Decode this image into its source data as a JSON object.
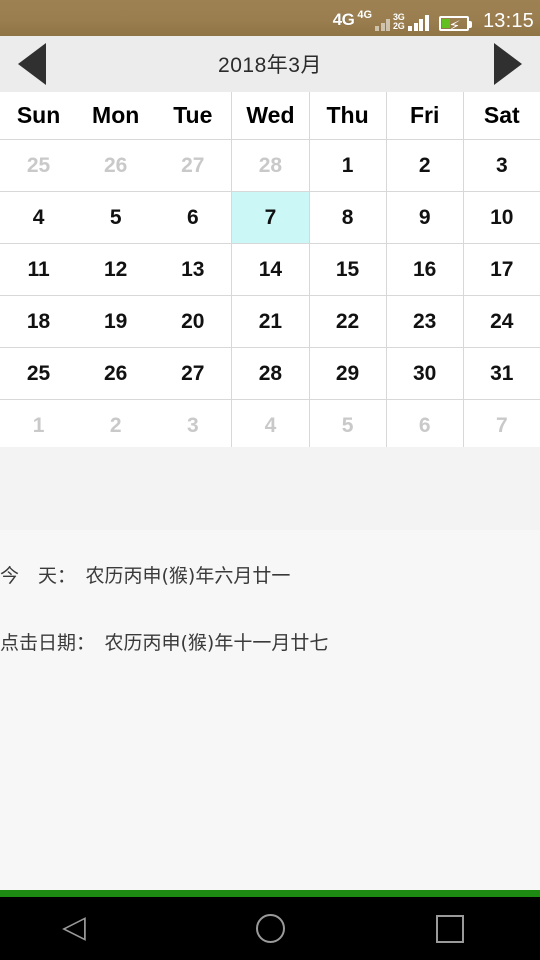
{
  "status_bar": {
    "network_primary": "4G",
    "network_secondary": "4G",
    "network_tertiary_top": "3G",
    "network_tertiary_bottom": "2G",
    "clock": "13:15",
    "background_color": "#9a7e4f"
  },
  "header": {
    "prev_label": "◀",
    "next_label": "▶",
    "title": "2018年3月"
  },
  "calendar": {
    "weekdays": [
      "Sun",
      "Mon",
      "Tue",
      "Wed",
      "Thu",
      "Fri",
      "Sat"
    ],
    "selected_color": "#ccf7f7",
    "rows": [
      [
        {
          "d": "25",
          "t": "prev"
        },
        {
          "d": "26",
          "t": "prev"
        },
        {
          "d": "27",
          "t": "prev"
        },
        {
          "d": "28",
          "t": "prev"
        },
        {
          "d": "1",
          "t": "cur"
        },
        {
          "d": "2",
          "t": "cur"
        },
        {
          "d": "3",
          "t": "cur"
        }
      ],
      [
        {
          "d": "4",
          "t": "cur"
        },
        {
          "d": "5",
          "t": "cur"
        },
        {
          "d": "6",
          "t": "cur"
        },
        {
          "d": "7",
          "t": "selected"
        },
        {
          "d": "8",
          "t": "cur"
        },
        {
          "d": "9",
          "t": "cur"
        },
        {
          "d": "10",
          "t": "cur"
        }
      ],
      [
        {
          "d": "11",
          "t": "cur"
        },
        {
          "d": "12",
          "t": "cur"
        },
        {
          "d": "13",
          "t": "cur"
        },
        {
          "d": "14",
          "t": "cur"
        },
        {
          "d": "15",
          "t": "cur"
        },
        {
          "d": "16",
          "t": "cur"
        },
        {
          "d": "17",
          "t": "cur"
        }
      ],
      [
        {
          "d": "18",
          "t": "cur"
        },
        {
          "d": "19",
          "t": "cur"
        },
        {
          "d": "20",
          "t": "cur"
        },
        {
          "d": "21",
          "t": "cur"
        },
        {
          "d": "22",
          "t": "cur"
        },
        {
          "d": "23",
          "t": "cur"
        },
        {
          "d": "24",
          "t": "cur"
        }
      ],
      [
        {
          "d": "25",
          "t": "cur"
        },
        {
          "d": "26",
          "t": "cur"
        },
        {
          "d": "27",
          "t": "cur"
        },
        {
          "d": "28",
          "t": "cur"
        },
        {
          "d": "29",
          "t": "cur"
        },
        {
          "d": "30",
          "t": "cur"
        },
        {
          "d": "31",
          "t": "cur"
        }
      ],
      [
        {
          "d": "1",
          "t": "next"
        },
        {
          "d": "2",
          "t": "next"
        },
        {
          "d": "3",
          "t": "next"
        },
        {
          "d": "4",
          "t": "next"
        },
        {
          "d": "5",
          "t": "next"
        },
        {
          "d": "6",
          "t": "next"
        },
        {
          "d": "7",
          "t": "next"
        }
      ]
    ]
  },
  "info": {
    "today_line": "今　天：　农历丙申(猴)年六月廿一",
    "clicked_line": "点击日期：　农历丙申(猴)年十一月廿七"
  },
  "nav_bar": {
    "accent_color": "#1d8a11",
    "back_label": "back-triangle",
    "home_label": "home-circle",
    "recent_label": "recents-square"
  }
}
